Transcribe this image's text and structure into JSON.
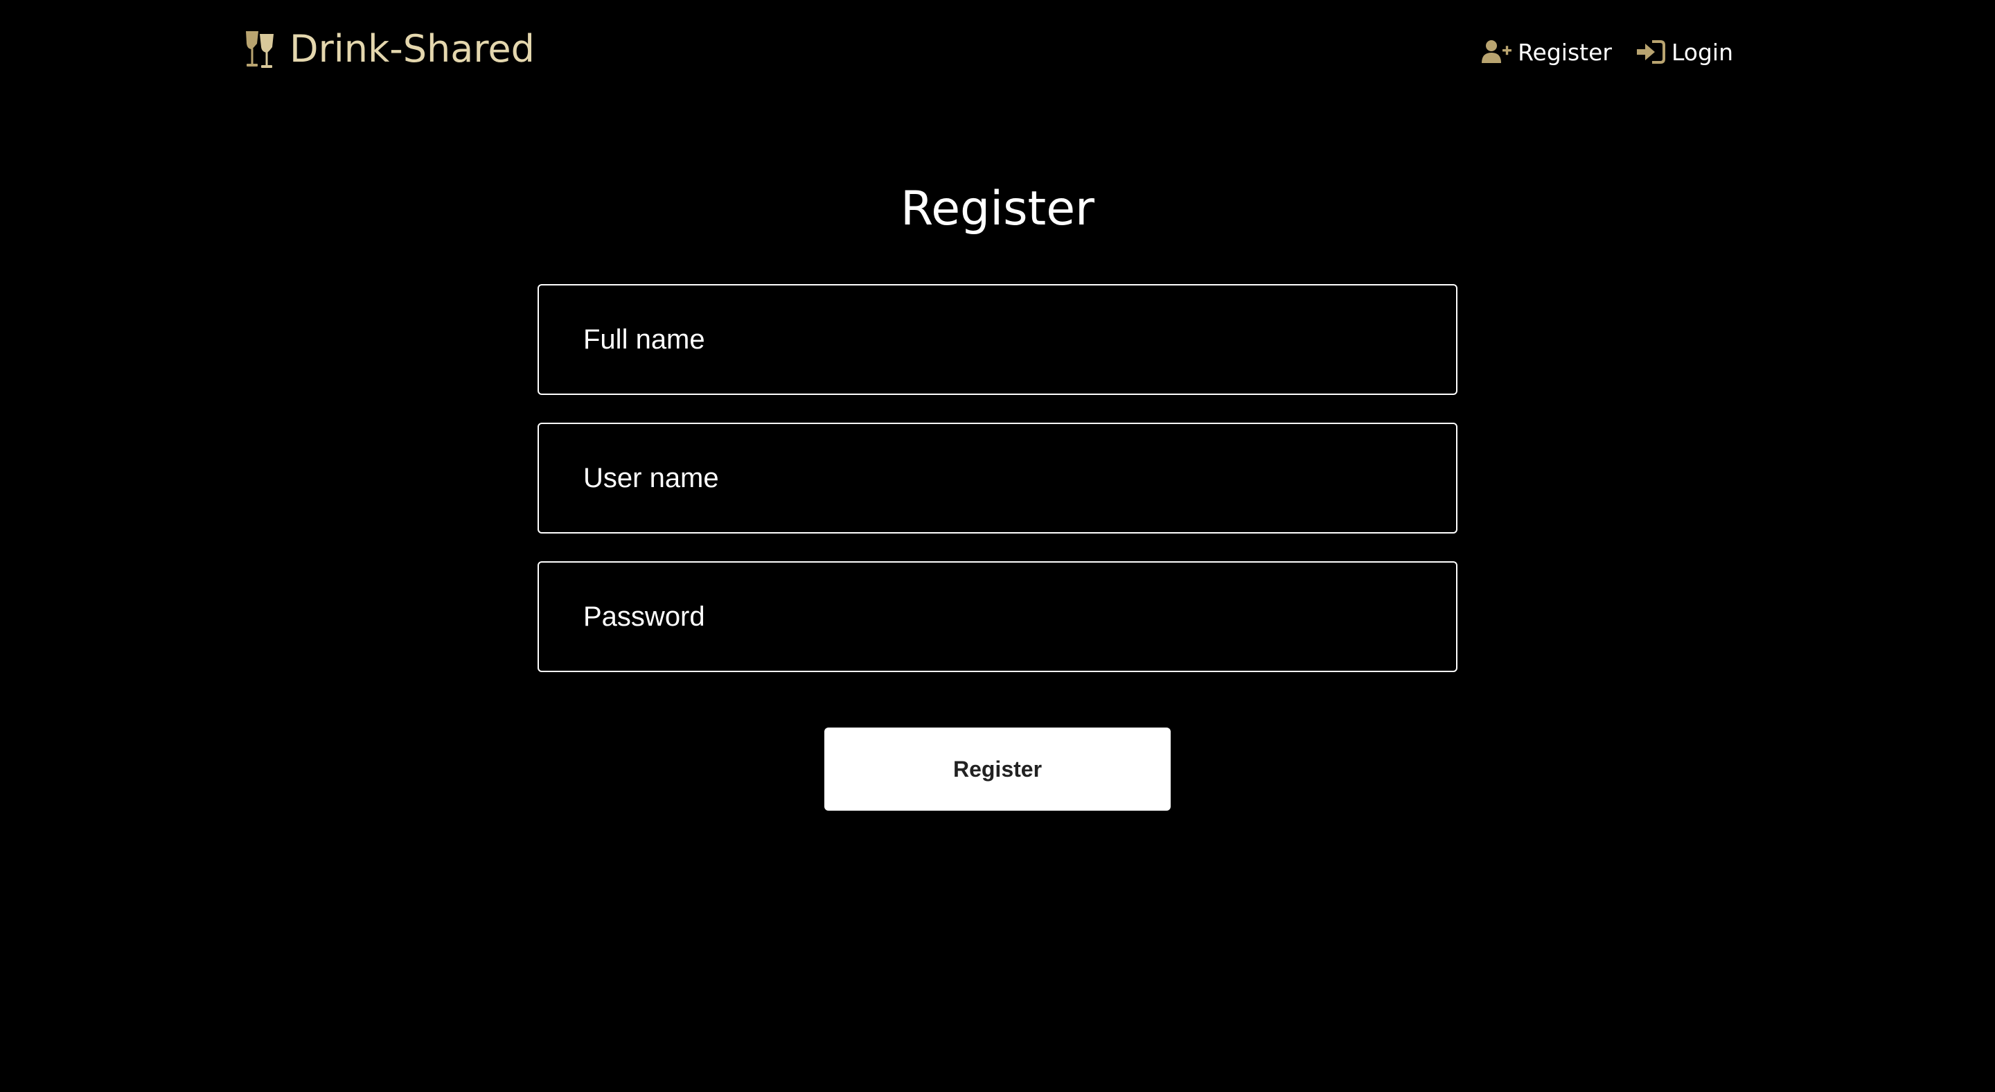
{
  "colors": {
    "background": "#000000",
    "brand": "#e4d7ae",
    "icon_accent": "#b9a470",
    "text": "#ffffff",
    "button_bg": "#ffffff",
    "button_text": "#222222"
  },
  "header": {
    "brand_icon": "wine-glasses-icon",
    "brand_name": "Drink-Shared",
    "nav": [
      {
        "icon": "user-plus-icon",
        "label": "Register"
      },
      {
        "icon": "sign-in-icon",
        "label": "Login"
      }
    ]
  },
  "main": {
    "title": "Register",
    "fields": {
      "full_name": {
        "value": "",
        "placeholder": "Full name"
      },
      "user_name": {
        "value": "",
        "placeholder": "User name"
      },
      "password": {
        "value": "",
        "placeholder": "Password"
      }
    },
    "submit_label": "Register"
  }
}
